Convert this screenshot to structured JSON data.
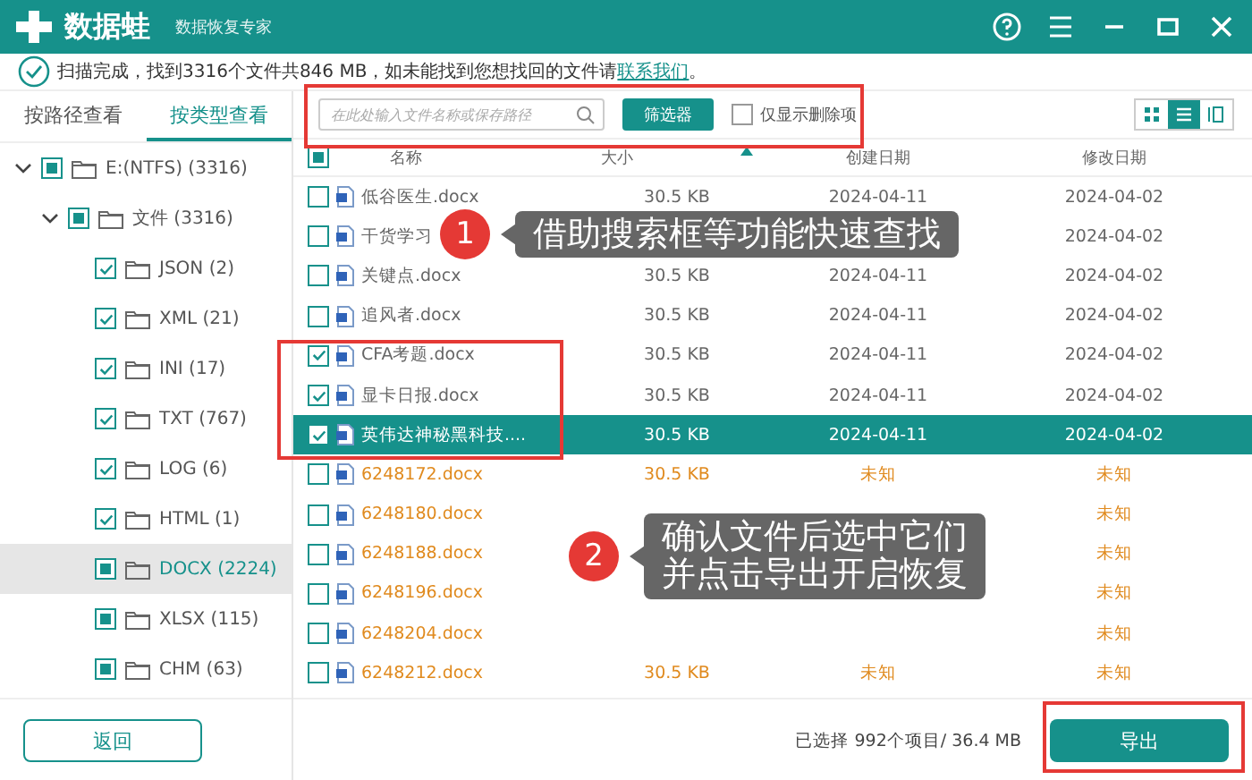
{
  "title_bar": {
    "app_name": "数据蛙",
    "subtitle": "数据恢复专家"
  },
  "notice": {
    "text": "扫描完成，找到3316个文件共846 MB，如未能找到您想找回的文件请",
    "link": "联系我们",
    "text_after": "。"
  },
  "tabs": [
    {
      "label": "按路径查看",
      "selected": false
    },
    {
      "label": "按类型查看",
      "selected": true
    }
  ],
  "tree": [
    {
      "label": "E:(NTFS) (3316)",
      "checked": false,
      "indeterminate": true,
      "expanded": true,
      "selected": false,
      "children": [
        {
          "label": "文件 (3316)",
          "checked": false,
          "indeterminate": true,
          "expanded": true,
          "selected": false,
          "children": [
            {
              "label": "JSON (2)",
              "checked": true,
              "selected": false
            },
            {
              "label": "XML (21)",
              "checked": true,
              "selected": false
            },
            {
              "label": "INI (17)",
              "checked": true,
              "selected": false
            },
            {
              "label": "TXT (767)",
              "checked": true,
              "selected": false
            },
            {
              "label": "LOG (6)",
              "checked": true,
              "selected": false
            },
            {
              "label": "HTML (1)",
              "checked": true,
              "selected": false
            },
            {
              "label": "DOCX (2224)",
              "checked": false,
              "indeterminate": true,
              "selected": true
            },
            {
              "label": "XLSX (115)",
              "checked": false,
              "indeterminate": true,
              "selected": false
            },
            {
              "label": "CHM (63)",
              "checked": false,
              "indeterminate": true,
              "selected": false
            }
          ]
        }
      ]
    }
  ],
  "back_button": "返回",
  "search": {
    "placeholder": "在此处输入文件名称或保存路径"
  },
  "filter_button": "筛选器",
  "deleted_only": {
    "label": "仅显示删除项",
    "checked": false
  },
  "views": [
    {
      "kind": "grid",
      "selected": false
    },
    {
      "kind": "list",
      "selected": true
    },
    {
      "kind": "columns",
      "selected": false
    }
  ],
  "table": {
    "header_checkbox": {
      "checked": false,
      "indeterminate": true
    },
    "columns": [
      "名称",
      "大小",
      "创建日期",
      "修改日期"
    ],
    "rows": [
      {
        "name": "低谷医生.docx",
        "size": "30.5 KB",
        "created": "2024-04-11",
        "modified": "2024-04-02",
        "kind": "found",
        "checked": false,
        "selected": false
      },
      {
        "name": "干货学习",
        "modified": "2024-04-02",
        "kind": "found",
        "checked": false,
        "selected": false
      },
      {
        "name": "关键点.docx",
        "size": "30.5 KB",
        "created": "2024-04-11",
        "modified": "2024-04-02",
        "kind": "found",
        "checked": false,
        "selected": false
      },
      {
        "name": "追风者.docx",
        "size": "30.5 KB",
        "created": "2024-04-11",
        "modified": "2024-04-02",
        "kind": "found",
        "checked": false,
        "selected": false
      },
      {
        "name": "CFA考题.docx",
        "size": "30.5 KB",
        "created": "2024-04-11",
        "modified": "2024-04-02",
        "kind": "found",
        "checked": true,
        "selected": false
      },
      {
        "name": "显卡日报.docx",
        "size": "30.5 KB",
        "created": "2024-04-11",
        "modified": "2024-04-02",
        "kind": "found",
        "checked": true,
        "selected": false
      },
      {
        "name": "英伟达神秘黑科技....",
        "size": "30.5 KB",
        "created": "2024-04-11",
        "modified": "2024-04-02",
        "kind": "found",
        "checked": true,
        "selected": true
      },
      {
        "name": "6248172.docx",
        "size": "30.5 KB",
        "created": "未知",
        "modified": "未知",
        "kind": "unknown",
        "checked": false,
        "selected": false
      },
      {
        "name": "6248180.docx",
        "modified": "未知",
        "kind": "unknown",
        "checked": false,
        "selected": false
      },
      {
        "name": "6248188.docx",
        "modified": "未知",
        "kind": "unknown",
        "checked": false,
        "selected": false
      },
      {
        "name": "6248196.docx",
        "modified": "未知",
        "kind": "unknown",
        "checked": false,
        "selected": false
      },
      {
        "name": "6248204.docx",
        "modified": "未知",
        "kind": "unknown",
        "checked": false,
        "selected": false
      },
      {
        "name": "6248212.docx",
        "size": "30.5 KB",
        "created": "未知",
        "modified": "未知",
        "kind": "unknown",
        "checked": false,
        "selected": false
      }
    ]
  },
  "selection_summary": "已选择 992个项目/ 36.4 MB",
  "export_button": "导出",
  "callouts": [
    {
      "number": "1",
      "lines": [
        "借助搜索框等功能快速查找"
      ]
    },
    {
      "number": "2",
      "lines": [
        "确认文件后选中它们",
        "并点击导出开启恢复"
      ]
    }
  ]
}
